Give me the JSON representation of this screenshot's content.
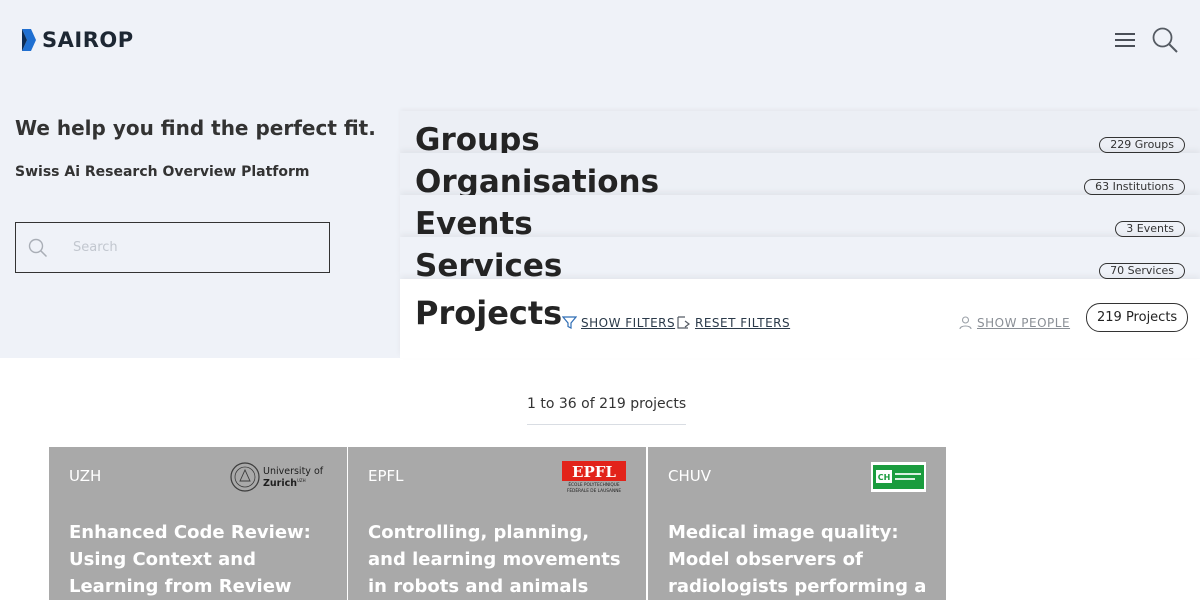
{
  "header": {
    "brand": "SAIROP",
    "brand_color": "#1d2733",
    "menu_icon": "hamburger-icon",
    "search_icon": "search-icon"
  },
  "hero": {
    "tagline": "We help you find the perfect fit.",
    "subtitle": "Swiss Ai Research Overview Platform",
    "search_placeholder": "Search"
  },
  "categories": [
    {
      "title": "Groups",
      "badge": "229 Groups"
    },
    {
      "title": "Organisations",
      "badge": "63 Institutions"
    },
    {
      "title": "Events",
      "badge": "3 Events"
    },
    {
      "title": "Services",
      "badge": "70 Services"
    }
  ],
  "projects": {
    "title": "Projects",
    "show_filters": "SHOW FILTERS",
    "reset_filters": "RESET FILTERS",
    "show_people": "SHOW PEOPLE",
    "badge": "219 Projects"
  },
  "results": {
    "count_text": "1 to 36 of 219 projects"
  },
  "cards": [
    {
      "institution": "UZH",
      "logo_text": "University of Zurich",
      "logo_text_extra": "UZH",
      "title": "Enhanced Code Review: Using Context and Learning from Review Experience"
    },
    {
      "institution": "EPFL",
      "logo_text": "EPFL",
      "logo_subtext": "ÉCOLE POLYTECHNIQUE FÉDÉRALE DE LAUSANNE",
      "title": "Controlling, planning, and learning movements in robots and animals"
    },
    {
      "institution": "CHUV",
      "logo_text": "CHUV",
      "title": "Medical image quality: Model observers of radiologists performing a search task and"
    }
  ],
  "colors": {
    "top_background": "#eff2f8",
    "card_background": "#a9a9a9",
    "epfl_red": "#e2231a",
    "chuv_green": "#1a9c3e",
    "logo_blue": "#1f6fd1"
  }
}
